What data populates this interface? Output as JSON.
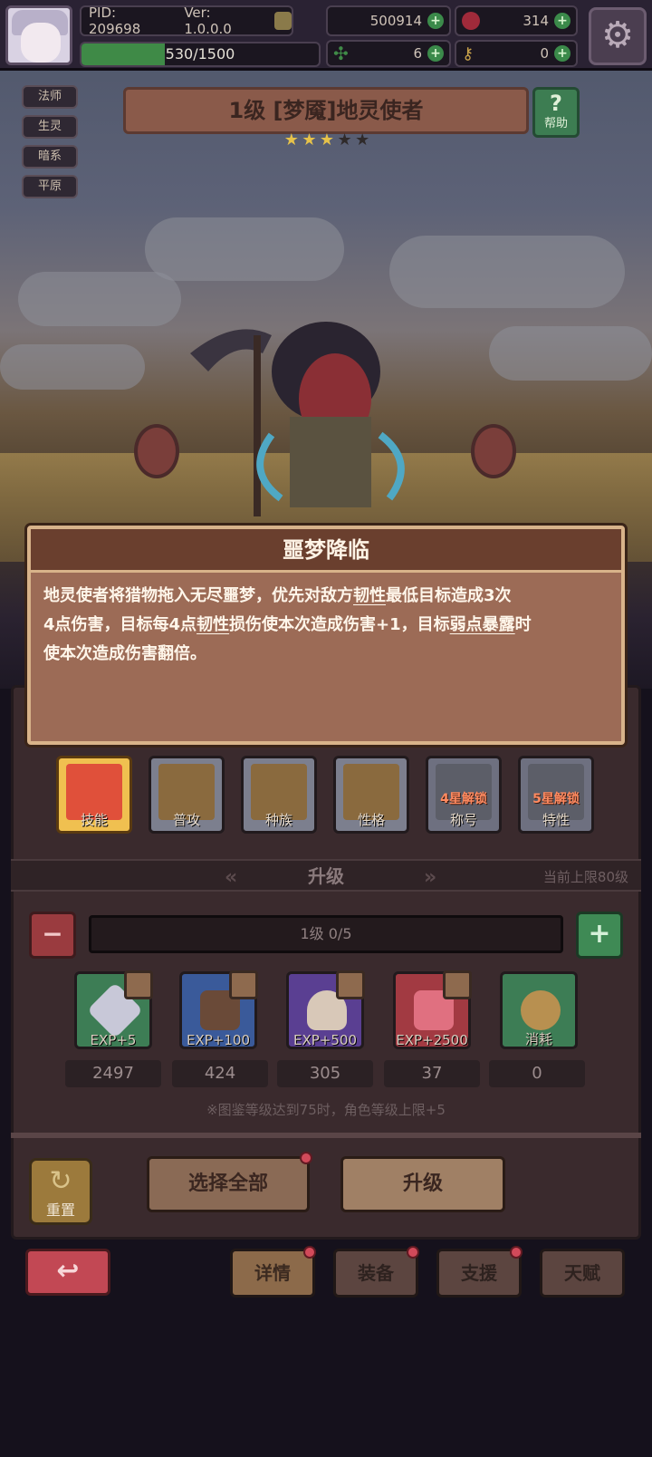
{
  "topbar": {
    "pid": "PID: 209698",
    "version": "Ver: 1.0.0.0",
    "gold": "500914",
    "gems": "314",
    "clover": "6",
    "keys": "0",
    "exp_text": "530/1500",
    "exp_fraction": 0.353
  },
  "tags": [
    "法师",
    "生灵",
    "暗系",
    "平原"
  ],
  "hero": {
    "title": "1级  [梦魇]地灵使者",
    "help_label": "帮助",
    "stars_filled": 3,
    "stars_total": 5
  },
  "skill": {
    "name": "噩梦降临",
    "line1_a": "地灵使者将猎物拖入无尽噩梦，优先对敌方",
    "kw_toughness": "韧性",
    "line1_b": "最低目标造成3次",
    "line2_a": "4点伤害，目标每4点",
    "line2_b": "损伤使本次造成伤害+1，目标",
    "kw_weakness": "弱点暴露",
    "line2_c": "时",
    "line3": "使本次造成伤害翻倍。"
  },
  "tabs": [
    {
      "label": "技能",
      "lock": ""
    },
    {
      "label": "普攻",
      "lock": ""
    },
    {
      "label": "种族",
      "lock": ""
    },
    {
      "label": "性格",
      "lock": ""
    },
    {
      "label": "称号",
      "lock": "4星解锁"
    },
    {
      "label": "特性",
      "lock": "5星解锁"
    }
  ],
  "upgrade": {
    "title": "升级",
    "cap": "当前上限80级",
    "level_text": "1级  0/5",
    "items": [
      {
        "label": "EXP+5",
        "count": "2497"
      },
      {
        "label": "EXP+100",
        "count": "424"
      },
      {
        "label": "EXP+500",
        "count": "305"
      },
      {
        "label": "EXP+2500",
        "count": "37"
      },
      {
        "label": "消耗",
        "count": "0"
      }
    ],
    "note": "※图鉴等级达到75时，角色等级上限+5",
    "reset_label": "重置",
    "select_all": "选择全部",
    "upgrade_btn": "升级"
  },
  "nav": [
    "详情",
    "装备",
    "支援",
    "天赋"
  ],
  "icons": {
    "gear": "gear-icon",
    "back": "back-arrow-icon",
    "help": "question-icon"
  },
  "colors": {
    "accent_green": "#3f8a47",
    "popup_bg": "#9c6b56",
    "back_red": "#c24854"
  }
}
